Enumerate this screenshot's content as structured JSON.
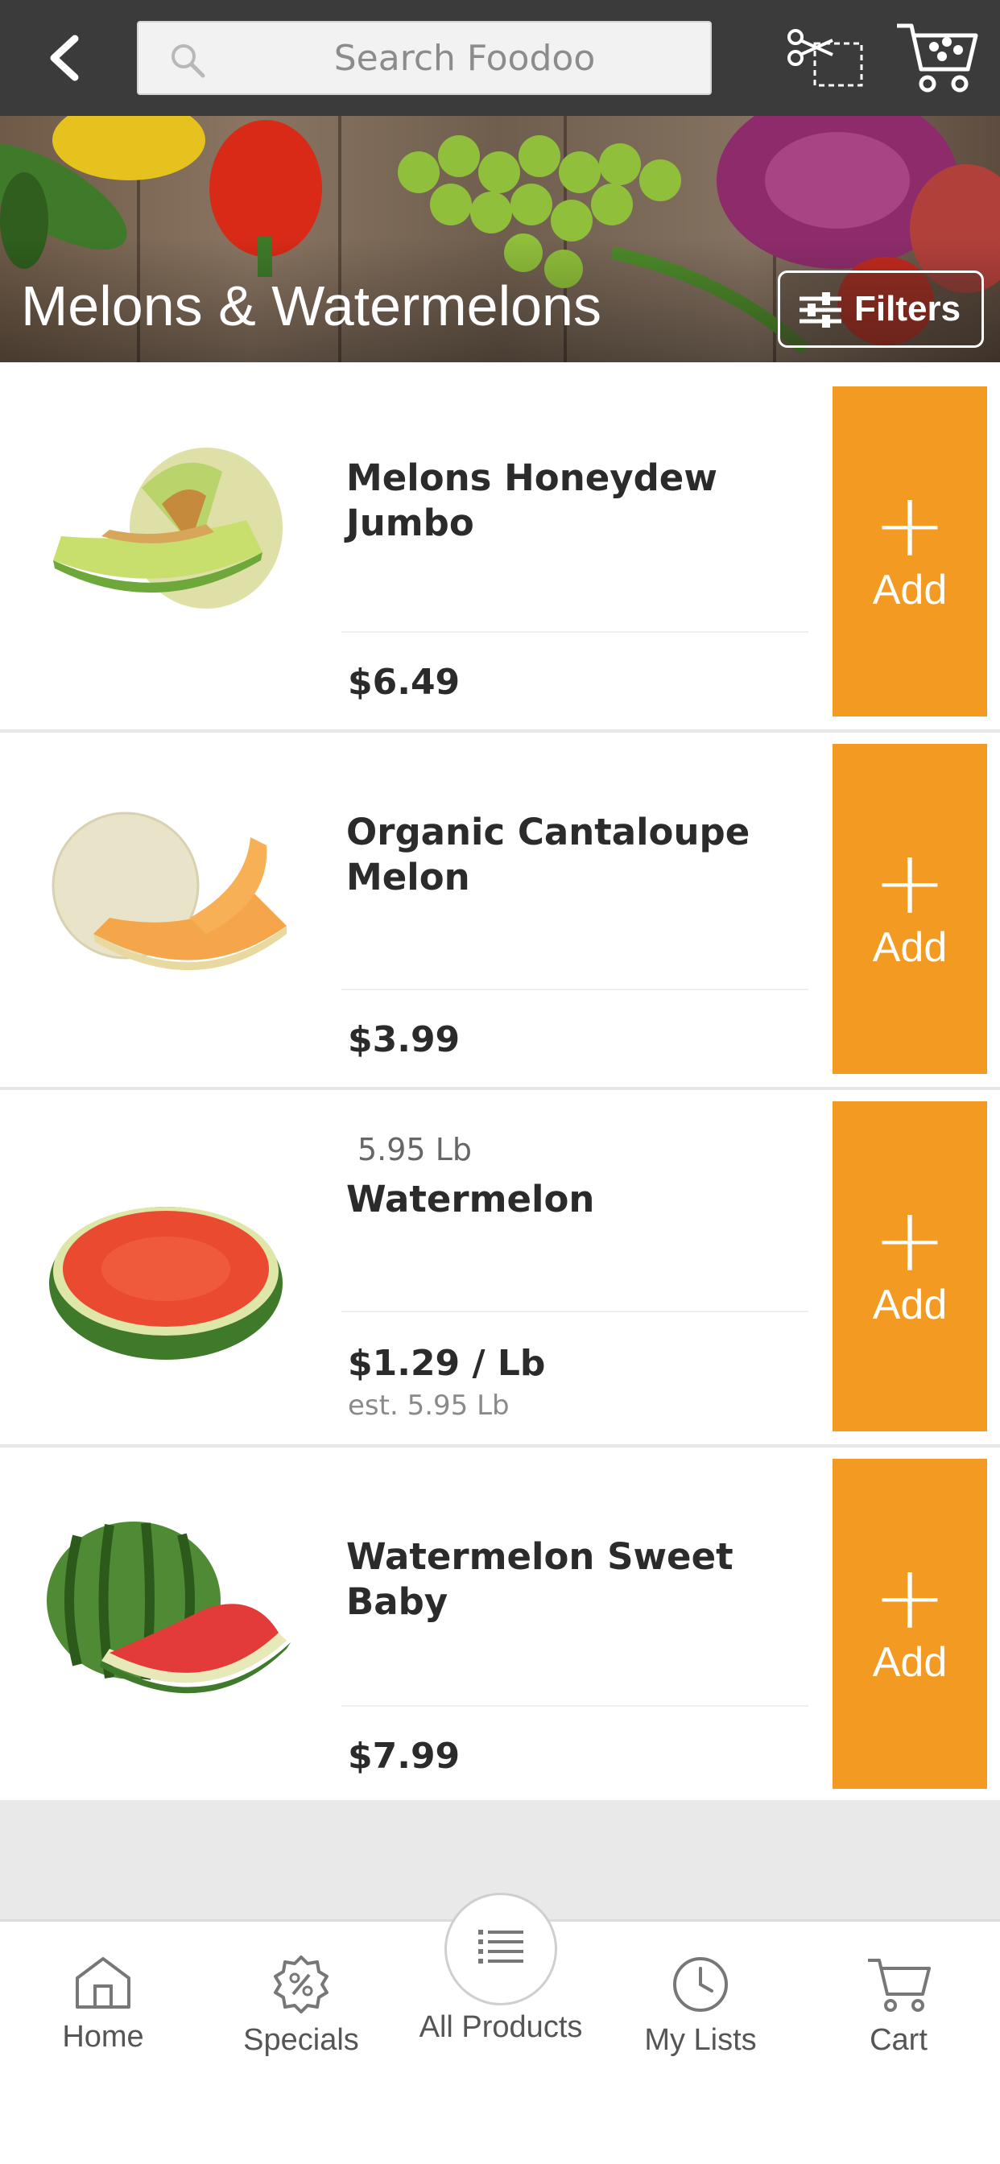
{
  "header": {
    "search_placeholder": "Search Foodoo"
  },
  "banner": {
    "title": "Melons & Watermelons",
    "filters_label": "Filters"
  },
  "products": [
    {
      "name": "Melons Honeydew Jumbo",
      "price": "$6.49",
      "add_label": "Add",
      "image": "honeydew-melon"
    },
    {
      "name": "Organic Cantaloupe Melon",
      "price": "$3.99",
      "add_label": "Add",
      "image": "cantaloupe-melon"
    },
    {
      "name": "Watermelon",
      "weight_tag": "5.95 Lb",
      "price": "$1.29 / Lb",
      "est": "est. 5.95 Lb",
      "add_label": "Add",
      "image": "watermelon-half"
    },
    {
      "name": "Watermelon Sweet Baby",
      "price": "$7.99",
      "add_label": "Add",
      "image": "baby-watermelon"
    }
  ],
  "bottom_nav": {
    "items": [
      {
        "label": "Home",
        "icon": "home-icon"
      },
      {
        "label": "Specials",
        "icon": "percent-badge-icon"
      },
      {
        "label": "All Products",
        "icon": "list-icon"
      },
      {
        "label": "My Lists",
        "icon": "clock-icon"
      },
      {
        "label": "Cart",
        "icon": "cart-icon"
      }
    ]
  },
  "colors": {
    "topbar": "#3b3b3b",
    "accent_orange": "#f39a22",
    "footer_gray": "#e9e9e9"
  }
}
